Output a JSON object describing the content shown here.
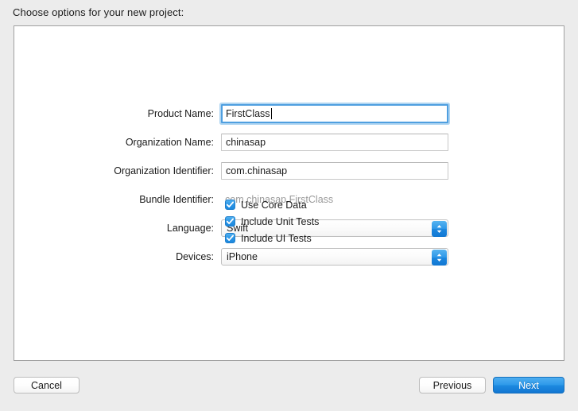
{
  "header": {
    "prompt": "Choose options for your new project:"
  },
  "form": {
    "fields": [
      {
        "label": "Product Name:",
        "value": "FirstClass",
        "type": "text",
        "focused": true
      },
      {
        "label": "Organization Name:",
        "value": "chinasap",
        "type": "text",
        "focused": false
      },
      {
        "label": "Organization Identifier:",
        "value": "com.chinasap",
        "type": "text",
        "focused": false
      },
      {
        "label": "Bundle Identifier:",
        "value": "com.chinasap.FirstClass",
        "type": "static",
        "focused": false
      },
      {
        "label": "Language:",
        "value": "Swift",
        "type": "popup",
        "focused": false
      },
      {
        "label": "Devices:",
        "value": "iPhone",
        "type": "popup",
        "focused": false
      }
    ]
  },
  "checkboxes": [
    {
      "label": "Use Core Data",
      "checked": true
    },
    {
      "label": "Include Unit Tests",
      "checked": true
    },
    {
      "label": "Include UI Tests",
      "checked": true
    }
  ],
  "footer": {
    "cancel_label": "Cancel",
    "previous_label": "Previous",
    "next_label": "Next"
  },
  "colors": {
    "accent_blue": "#1d89e0",
    "focus_ring": "#6db3e8",
    "window_background": "#ececec",
    "panel_background": "#ffffff",
    "static_text": "#9a9a9a"
  }
}
